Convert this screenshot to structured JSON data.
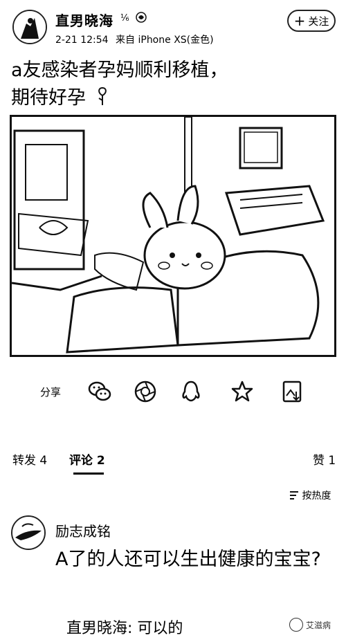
{
  "header": {
    "username": "直男晓海",
    "timestamp": "2-21 12:54",
    "source": "来自 iPhone XS(金色)",
    "follow_label": "关注",
    "follow_plus": "+"
  },
  "post": {
    "lines": [
      "a友感染者孕妈顺利移植，",
      "期待好孕"
    ]
  },
  "share": {
    "label": "分享",
    "icons": [
      "wechat-icon",
      "moments-icon",
      "qq-icon",
      "favorite-star-icon",
      "save-image-icon"
    ]
  },
  "tabs": {
    "repost": "转发 4",
    "comments": "评论 2",
    "likes": "赞 1"
  },
  "sort": {
    "label": "按热度"
  },
  "comment": {
    "author": "励志成铭",
    "text": "A了的人还可以生出健康的宝宝?"
  },
  "reply": {
    "text": "直男晓海: 可以的"
  },
  "watermark": {
    "text": "艾滋病"
  }
}
